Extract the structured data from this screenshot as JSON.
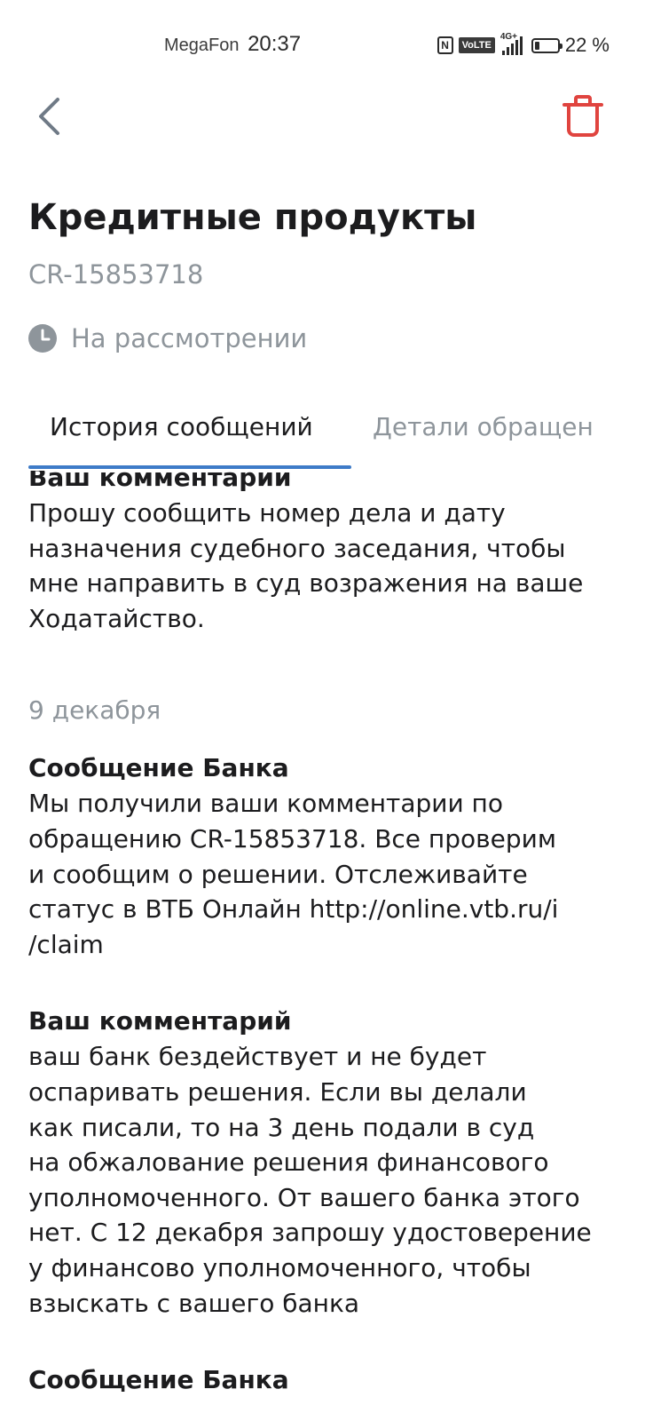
{
  "status_bar": {
    "carrier": "MegaFon",
    "time": "20:37",
    "nfc": "N",
    "volte": "VoLTE",
    "network": "4G+",
    "battery_level": 0.22,
    "battery_text": "22 %"
  },
  "header": {
    "back_icon": "chevron-left-icon",
    "delete_icon": "trash-icon",
    "accent_delete": "#e0443f"
  },
  "claim": {
    "title": "Кредитные продукты",
    "id": "CR-15853718",
    "status_icon": "clock-icon",
    "status": "На рассмотрении"
  },
  "tabs": [
    {
      "label": "История сообщений",
      "active": true
    },
    {
      "label": "Детали обращен",
      "active": false
    }
  ],
  "accent_color": "#3e7bc8",
  "messages": [
    {
      "author": "Ваш комментарий",
      "text": "Прошу сообщить номер дела и дату\nназначения судебного заседания, чтобы\nмне направить в суд возражения на ваше\nХодатайство."
    },
    {
      "date": "9 декабря"
    },
    {
      "author": "Сообщение Банка",
      "text": "Мы получили ваши комментарии по\nобращению CR-15853718. Все проверим\nи сообщим о решении. Отслеживайте\nстатус в ВТБ Онлайн http://online.vtb.ru/i\n/claim"
    },
    {
      "author": "Ваш комментарий",
      "text": "ваш банк бездействует и не будет\nоспаривать решения. Если вы делали\nкак писали, то на 3 день подали в суд\nна обжалование решения финансового\nуполномоченного. От вашего банка этого\nнет. С 12 декабря запрошу удостоверение\nу финансово уполномоченного, чтобы\nвзыскать с вашего банка"
    },
    {
      "author": "Сообщение Банка"
    }
  ]
}
